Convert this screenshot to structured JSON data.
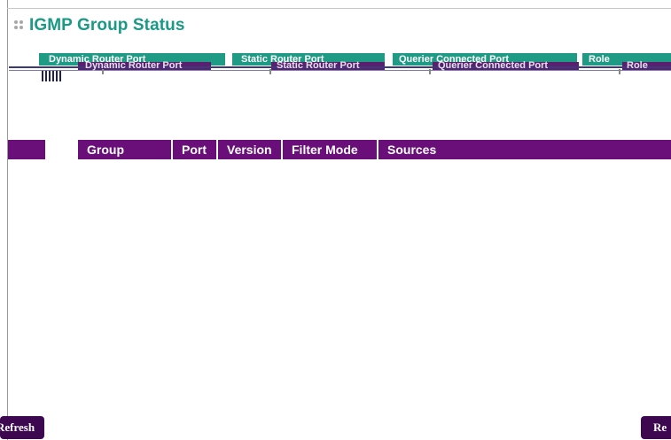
{
  "page": {
    "title": "IGMP Group Status"
  },
  "port_tabs": {
    "dynamic_router_port": "Dynamic Router Port",
    "static_router_port": "Static Router Port",
    "querier_connected_port": "Querier Connected Port",
    "role": "Role"
  },
  "table": {
    "columns": [
      "Group",
      "Port",
      "Version",
      "Filter Mode",
      "Sources"
    ],
    "rows": []
  },
  "buttons": {
    "refresh": "Refresh",
    "right": "Re"
  },
  "colors": {
    "title_teal": "#1a9a86",
    "header_purple": "#6a0f7a",
    "button_purple": "#3d0850",
    "tab_green": "#1f9a84"
  }
}
